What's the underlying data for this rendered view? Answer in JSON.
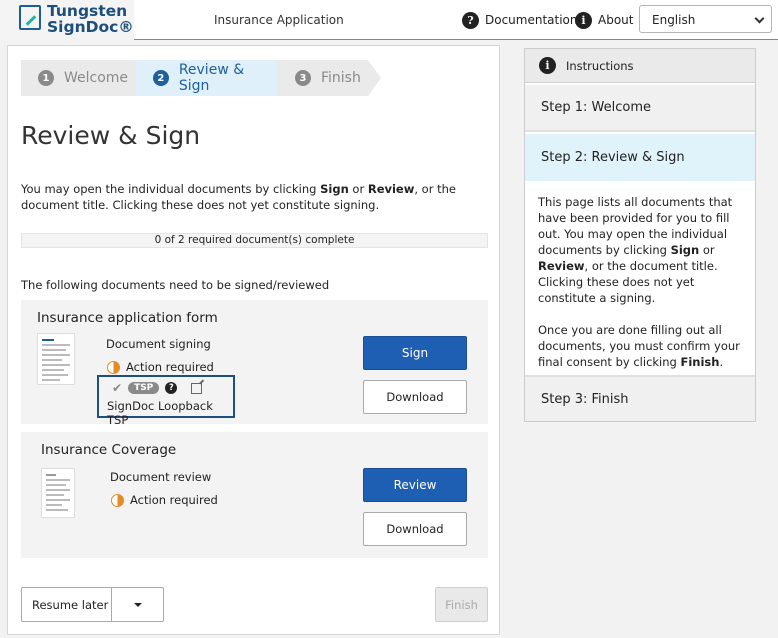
{
  "header": {
    "logo_line1": "Tungsten",
    "logo_line2": "SignDoc®",
    "app_title": "Insurance Application",
    "documentation_label": "Documentation",
    "documentation_icon": "question-circle-icon",
    "about_label": "About",
    "about_icon": "info-circle-icon",
    "language_selected": "English"
  },
  "stepper": {
    "steps": [
      {
        "num": "1",
        "label": "Welcome"
      },
      {
        "num": "2",
        "label": "Review & Sign"
      },
      {
        "num": "3",
        "label": "Finish"
      }
    ],
    "active": "Review & Sign"
  },
  "main": {
    "title": "Review & Sign",
    "intro_part1": "You may open the individual documents by clicking ",
    "intro_sign": "Sign",
    "intro_or": " or ",
    "intro_review": "Review",
    "intro_part2": ", or the document title. Clicking these does not yet constitute signing.",
    "progress_text": "0 of 2 required document(s) complete",
    "following_text": "The following documents need to be signed/reviewed"
  },
  "documents": [
    {
      "title": "Insurance application form",
      "type": "Document signing",
      "status": "Action required",
      "tsp_badge": "TSP",
      "tsp_name": "SignDoc Loopback TSP",
      "primary_action": "Sign",
      "secondary_action": "Download"
    },
    {
      "title": "Insurance Coverage",
      "type": "Document review",
      "status": "Action required",
      "primary_action": "Review",
      "secondary_action": "Download"
    }
  ],
  "footer": {
    "resume_label": "Resume later",
    "finish_label": "Finish"
  },
  "instructions": {
    "heading": "Instructions",
    "step1": "Step 1: Welcome",
    "step2": "Step 2: Review & Sign",
    "step3": "Step 3: Finish",
    "p1_a": "This page lists all documents that have been provided for you to fill out. You may open the individual documents by clicking ",
    "p1_sign": "Sign",
    "p1_or": " or ",
    "p1_review": "Review",
    "p1_b": ", or the document title. Clicking these does not yet constitute a signing.",
    "p2_a": "Once you are done filling out all documents, you must confirm your final consent by clicking ",
    "p2_finish": "Finish",
    "p2_b": "."
  },
  "colors": {
    "primary_button": "#1f5fb3",
    "active_step_bg": "#dff0fb",
    "active_step_text": "#1f5f9b",
    "action_required": "#e58a25",
    "logo": "#1d4f7a",
    "header_rule": "#3aa6a0"
  }
}
